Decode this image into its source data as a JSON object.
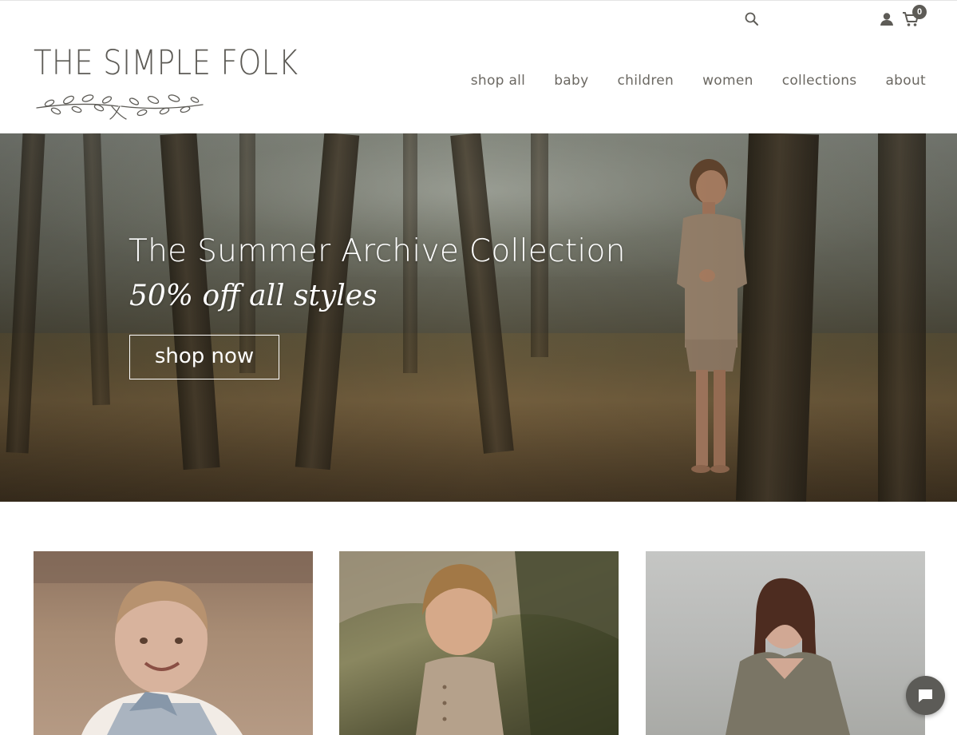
{
  "brand": {
    "name": "THE SIMPLE FOLK",
    "color": "#5d5b56"
  },
  "header": {
    "icons": [
      "search-icon",
      "account-icon",
      "cart-icon"
    ],
    "cart_count": "0"
  },
  "nav": {
    "items": [
      {
        "label": "shop all"
      },
      {
        "label": "baby"
      },
      {
        "label": "children"
      },
      {
        "label": "women"
      },
      {
        "label": "collections"
      },
      {
        "label": "about"
      }
    ]
  },
  "hero": {
    "title": "The Summer Archive Collection",
    "subtitle": "50% off all styles",
    "button_label": "shop now"
  },
  "tiles": [
    {
      "subject": "baby"
    },
    {
      "subject": "children"
    },
    {
      "subject": "women"
    }
  ],
  "chat": {
    "icon": "chat-icon"
  }
}
